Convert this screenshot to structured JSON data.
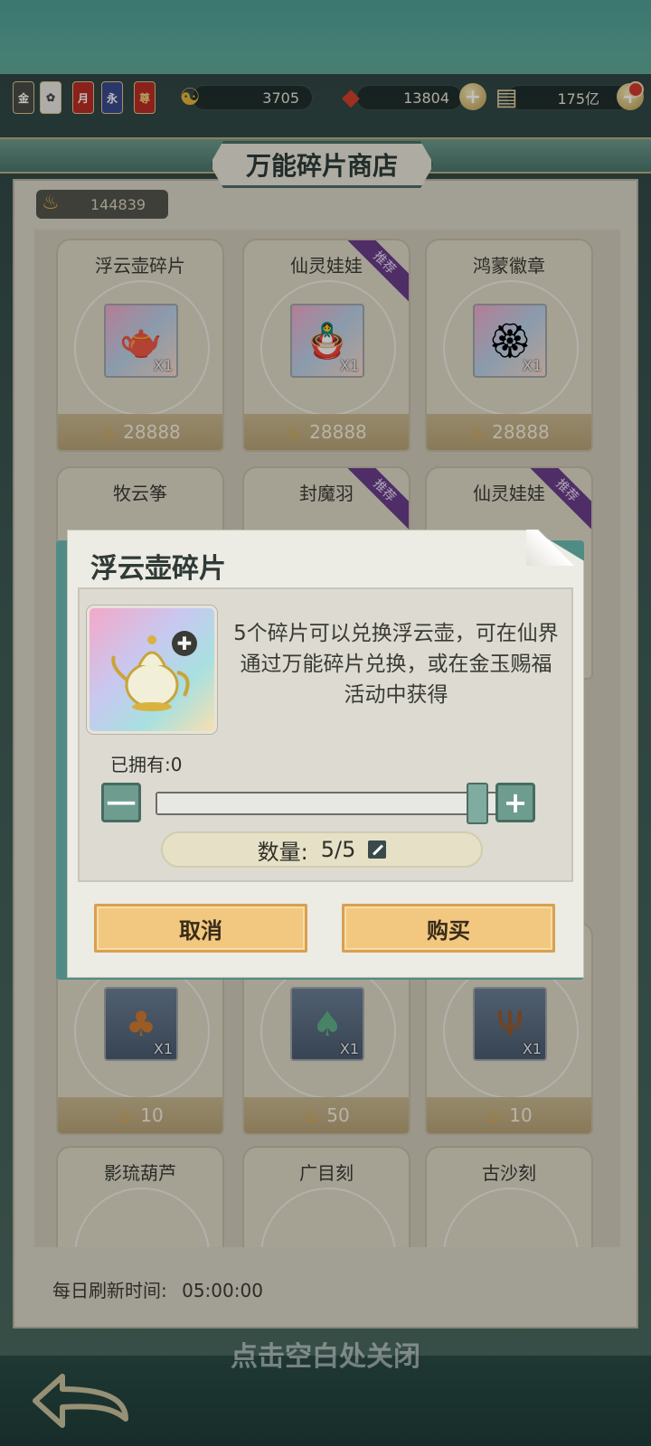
{
  "resources": {
    "badges": [
      "金",
      "",
      "月",
      "永",
      "尊"
    ],
    "yin_yang_value": "3705",
    "red_gem_value": "13804",
    "scroll_value": "175亿"
  },
  "shop": {
    "title": "万能碎片商店",
    "currency_value": "144839",
    "recommend_tag": "推荐",
    "items": [
      {
        "name": "浮云壶碎片",
        "qty": "X1",
        "price": "28888",
        "recommended": false,
        "icon": "teapot-icon"
      },
      {
        "name": "仙灵娃娃",
        "qty": "X1",
        "price": "28888",
        "recommended": true,
        "icon": "doll-icon"
      },
      {
        "name": "鸿蒙徽章",
        "qty": "X1",
        "price": "28888",
        "recommended": false,
        "icon": "badge-icon"
      },
      {
        "name": "牧云筝",
        "qty": "",
        "price": "",
        "recommended": false,
        "icon": ""
      },
      {
        "name": "封魔羽",
        "qty": "",
        "price": "",
        "recommended": true,
        "icon": ""
      },
      {
        "name": "仙灵娃娃",
        "qty": "",
        "price": "",
        "recommended": true,
        "icon": ""
      },
      {
        "name": "",
        "qty": "X1",
        "price": "10",
        "recommended": false,
        "icon": "gourd-icon"
      },
      {
        "name": "",
        "qty": "X1",
        "price": "50",
        "recommended": false,
        "icon": "jade-bottle-icon"
      },
      {
        "name": "",
        "qty": "X1",
        "price": "10",
        "recommended": false,
        "icon": "antler-icon"
      },
      {
        "name": "影琉葫芦",
        "qty": "",
        "price": "",
        "recommended": false,
        "icon": ""
      },
      {
        "name": "广目刻",
        "qty": "",
        "price": "",
        "recommended": false,
        "icon": ""
      },
      {
        "name": "古沙刻",
        "qty": "",
        "price": "",
        "recommended": false,
        "icon": ""
      }
    ],
    "refresh_label": "每日刷新时间:",
    "refresh_time": "05:00:00",
    "close_hint": "点击空白处关闭"
  },
  "dialog": {
    "title": "浮云壶碎片",
    "description": "5个碎片可以兑换浮云壶，可在仙界通过万能碎片兑换，或在金玉赐福活动中获得",
    "owned_label": "已拥有:0",
    "minus_label": "一",
    "plus_label": "+",
    "quantity_label": "数量:",
    "quantity_value": "5/5",
    "slider_fraction": 1.0,
    "cancel_label": "取消",
    "buy_label": "购买"
  }
}
